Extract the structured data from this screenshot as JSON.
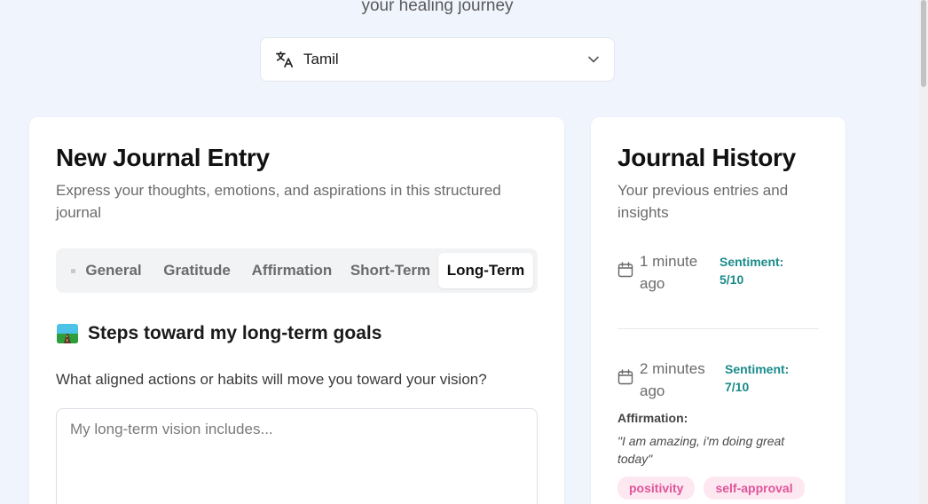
{
  "header": {
    "subtitle": "your healing journey"
  },
  "language": {
    "icon": "translate-icon",
    "selected": "Tamil"
  },
  "entry": {
    "title": "New Journal Entry",
    "description": "Express your thoughts, emotions, and aspirations in this structured journal",
    "tabs": [
      {
        "label": "General"
      },
      {
        "label": "Gratitude"
      },
      {
        "label": "Affirmation"
      },
      {
        "label": "Short-Term"
      },
      {
        "label": "Long-Term"
      }
    ],
    "active_tab": "Long-Term",
    "section_title": "Steps toward my long-term goals",
    "section_icon": "road-icon",
    "prompt": "What aligned actions or habits will move you toward your vision?",
    "placeholder": "My long-term vision includes..."
  },
  "history": {
    "title": "Journal History",
    "description": "Your previous entries and insights",
    "items": [
      {
        "time": "1 minute ago",
        "sentiment": "Sentiment: 5/10"
      },
      {
        "time": "2 minutes ago",
        "sentiment": "Sentiment: 7/10",
        "affirmation_label": "Affirmation:",
        "affirmation_text": "\"I am amazing, i'm doing great today\"",
        "tags": [
          "positivity",
          "self-approval"
        ]
      }
    ]
  },
  "colors": {
    "accent_teal": "#1a8a8a",
    "tag_pink": "#e0559a",
    "background": "#f0f4fd"
  }
}
